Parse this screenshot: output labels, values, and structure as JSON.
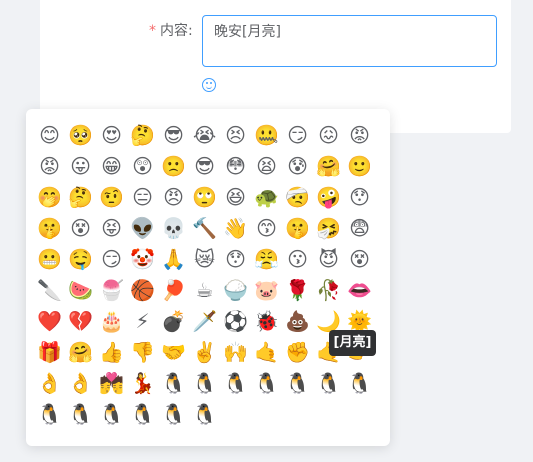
{
  "form": {
    "required_mark": "*",
    "label": "内容:",
    "content_value": "晚安[月亮]"
  },
  "tooltip": {
    "text": "[月亮]"
  },
  "emojis": [
    "😊",
    "🥺",
    "😍",
    "🤔",
    "😎",
    "😭",
    "😣",
    "🤐",
    "😏",
    "😖",
    "😡",
    "😡",
    "😛",
    "😁",
    "😲",
    "🙁",
    "😎",
    "😳",
    "😫",
    "😰",
    "🤗",
    "🙂",
    "🤭",
    "🤔",
    "🤨",
    "😑",
    "😠",
    "🙄",
    "😆",
    "🐢",
    "🤕",
    "🤪",
    "😯",
    "🤫",
    "😵",
    "😝",
    "👽",
    "💀",
    "🔨",
    "👋",
    "😙",
    "🤫",
    "🤧",
    "😨",
    "😬",
    "🤤",
    "😏",
    "🤡",
    "🙏",
    "😿",
    "😯",
    "😤",
    "😗",
    "😈",
    "😵",
    "🔪",
    "🍉",
    "🍧",
    "🏀",
    "🏓",
    "☕",
    "🍚",
    "🐷",
    "🌹",
    "🥀",
    "👄",
    "❤️",
    "💔",
    "🎂",
    "⚡",
    "💣",
    "🗡️",
    "⚽",
    "🐞",
    "💩",
    "🌙",
    "🌞",
    "🎁",
    "🤗",
    "👍",
    "👎",
    "🤝",
    "✌️",
    "🙌",
    "🤙",
    "✊",
    "🤙",
    "👉",
    "👌",
    "👌",
    "💏",
    "💃",
    "🐧",
    "🐧",
    "🐧",
    "🐧",
    "🐧",
    "🐧",
    "🐧",
    "🐧",
    "🐧",
    "🐧",
    "🐧",
    "🐧",
    "🐧"
  ]
}
